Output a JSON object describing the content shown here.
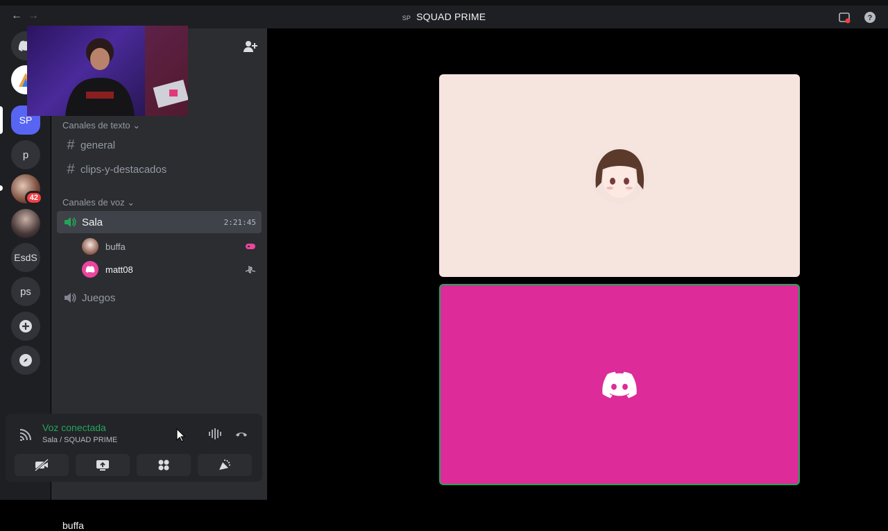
{
  "window": {
    "title": "SQUAD PRIME",
    "title_badge": "SP",
    "back": "←",
    "forward": "→"
  },
  "servers": [
    {
      "name": "home-button",
      "label": ""
    },
    {
      "name": "server-1",
      "label": ""
    },
    {
      "name": "server-squad-prime",
      "label": "SP"
    },
    {
      "name": "server-p",
      "label": "p"
    },
    {
      "name": "server-img-1",
      "label": "",
      "badge": "42"
    },
    {
      "name": "server-img-2",
      "label": ""
    },
    {
      "name": "server-esds",
      "label": "EsdS"
    },
    {
      "name": "server-ps",
      "label": "ps"
    }
  ],
  "categories": {
    "text": "Canales de texto",
    "voice": "Canales de voz"
  },
  "text_channels": [
    "general",
    "clips-y-destacados"
  ],
  "voice_channels": [
    {
      "name": "Sala",
      "timer": "2:21:45",
      "active": true
    },
    {
      "name": "Juegos",
      "active": false
    }
  ],
  "voice_members": [
    {
      "name": "buffa",
      "right_icon": "controller"
    },
    {
      "name": "matt08",
      "right_icon": "playstation"
    }
  ],
  "voice_panel": {
    "status": "Voz conectada",
    "subtitle": "Sala / SQUAD PRIME"
  },
  "user": {
    "name": "buffa"
  },
  "colors": {
    "accent": "#5865f2",
    "green": "#23a55a",
    "tile_pink": "#dd2b99",
    "tile_cream": "#f6e5df"
  }
}
